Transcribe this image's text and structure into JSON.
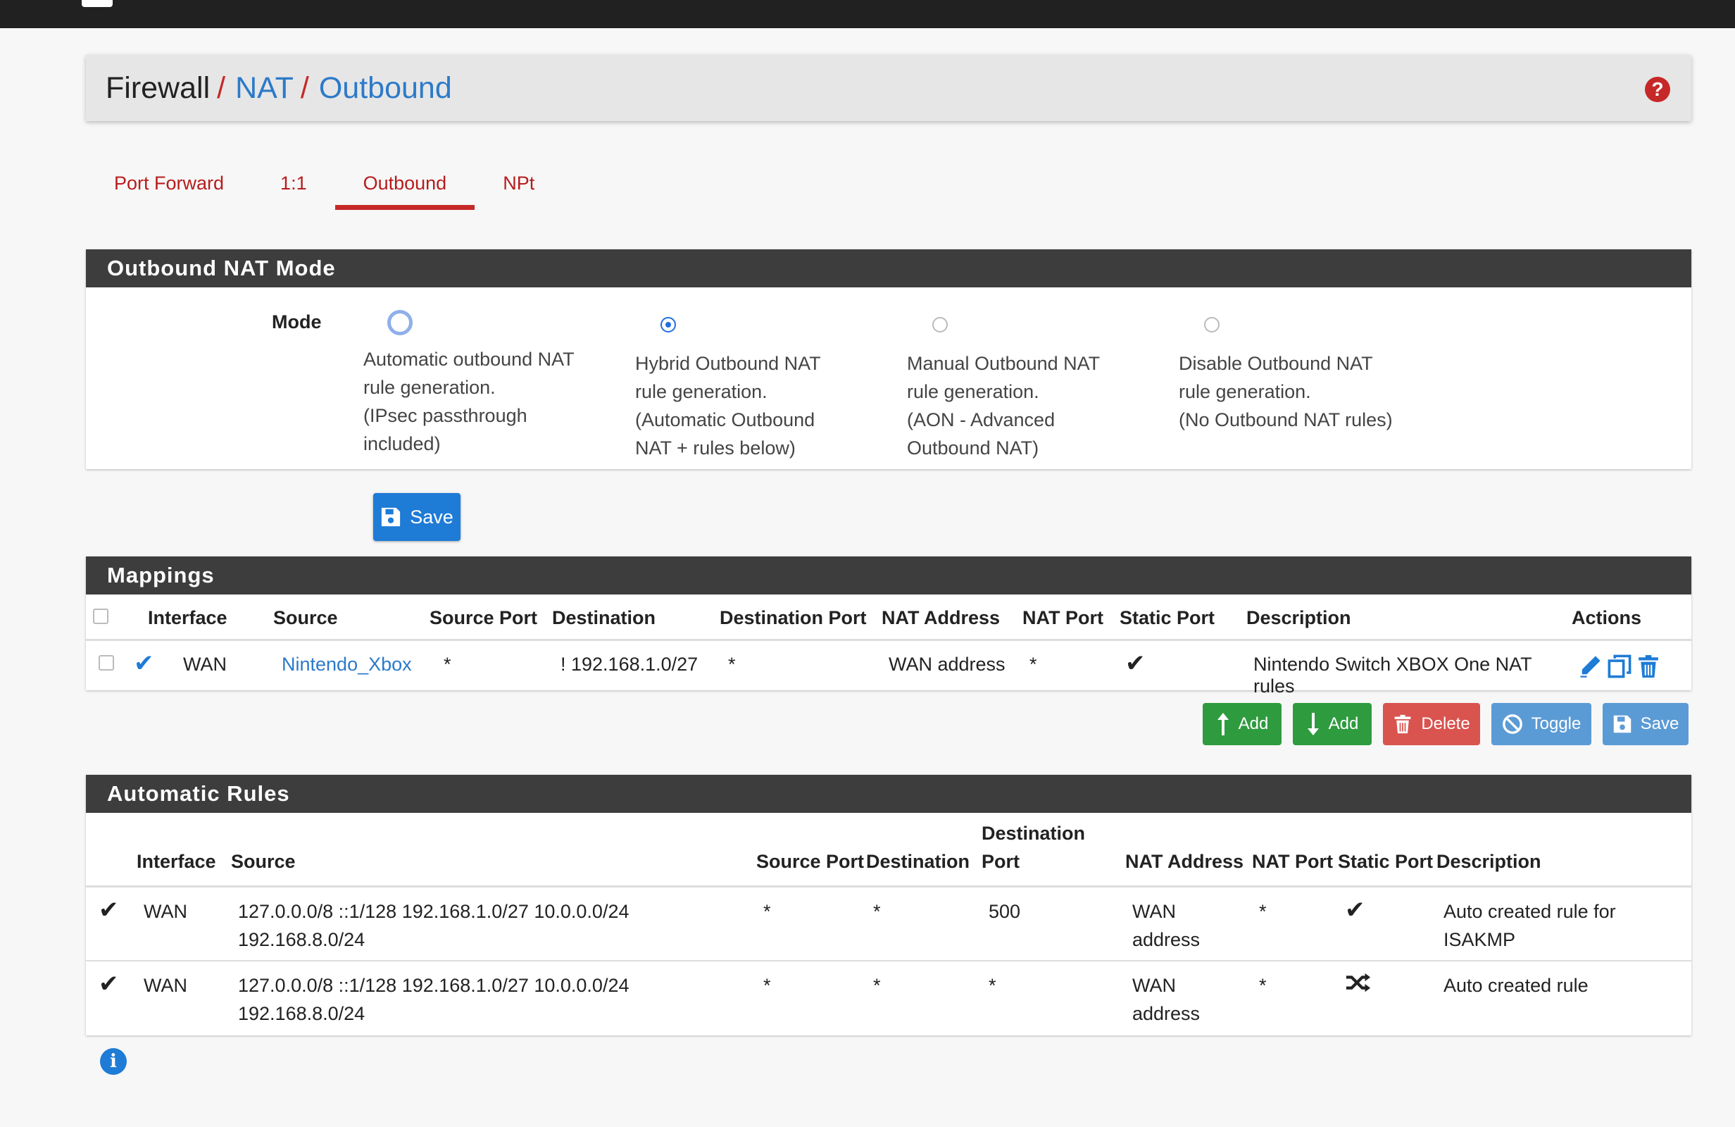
{
  "breadcrumb": {
    "root": "Firewall",
    "separator": "/",
    "level1": "NAT",
    "level2": "Outbound",
    "help_icon": "question-circle-icon"
  },
  "tabs": [
    {
      "label": "Port Forward",
      "active": false
    },
    {
      "label": "1:1",
      "active": false
    },
    {
      "label": "Outbound",
      "active": true
    },
    {
      "label": "NPt",
      "active": false
    }
  ],
  "mode_panel": {
    "title": "Outbound NAT Mode",
    "label": "Mode",
    "options": [
      {
        "text": "Automatic outbound NAT\nrule generation.\n(IPsec passthrough\nincluded)",
        "checked": false
      },
      {
        "text": "Hybrid Outbound NAT\nrule generation.\n(Automatic Outbound\nNAT + rules below)",
        "checked": true
      },
      {
        "text": "Manual Outbound NAT\nrule generation.\n(AON - Advanced\nOutbound NAT)",
        "checked": false
      },
      {
        "text": "Disable Outbound NAT\nrule generation.\n(No Outbound NAT rules)",
        "checked": false
      }
    ],
    "save_label": "Save"
  },
  "mappings": {
    "title": "Mappings",
    "columns": [
      "Interface",
      "Source",
      "Source Port",
      "Destination",
      "Destination Port",
      "NAT Address",
      "NAT Port",
      "Static Port",
      "Description",
      "Actions"
    ],
    "rows": [
      {
        "interface": "WAN",
        "source": "Nintendo_Xbox",
        "source_port": "*",
        "destination": "! 192.168.1.0/27",
        "destination_port": "*",
        "nat_address": "WAN address",
        "nat_port": "*",
        "static_port": "✔",
        "description": "Nintendo Switch XBOX One NAT rules"
      }
    ],
    "buttons": {
      "add_top": "Add",
      "add_bottom": "Add",
      "delete": "Delete",
      "toggle": "Toggle",
      "save": "Save"
    }
  },
  "automatic_rules": {
    "title": "Automatic Rules",
    "columns": {
      "interface": "Interface",
      "source": "Source",
      "source_port": "Source Port",
      "destination": "Destination",
      "destination_port": "Destination Port",
      "nat_address": "NAT Address",
      "nat_port": "NAT Port",
      "static_port": "Static Port",
      "description": "Description"
    },
    "rows": [
      {
        "interface": "WAN",
        "source": "127.0.0.0/8 ::1/128 192.168.1.0/27 10.0.0.0/24 192.168.8.0/24",
        "source_port": "*",
        "destination": "*",
        "destination_port": "500",
        "nat_address": "WAN address",
        "nat_port": "*",
        "static_port_icon": "check-icon",
        "description": "Auto created rule for ISAKMP"
      },
      {
        "interface": "WAN",
        "source": "127.0.0.0/8 ::1/128 192.168.1.0/27 10.0.0.0/24 192.168.8.0/24",
        "source_port": "*",
        "destination": "*",
        "destination_port": "*",
        "nat_address": "WAN address",
        "nat_port": "*",
        "static_port_icon": "shuffle-icon",
        "description": "Auto created rule"
      }
    ]
  },
  "colors": {
    "accent_red": "#c62828",
    "link_blue": "#2c7ac9",
    "panel_header": "#3d3d3d",
    "green": "#2e9b3f",
    "danger": "#d9534f",
    "info": "#5b9bd5"
  }
}
